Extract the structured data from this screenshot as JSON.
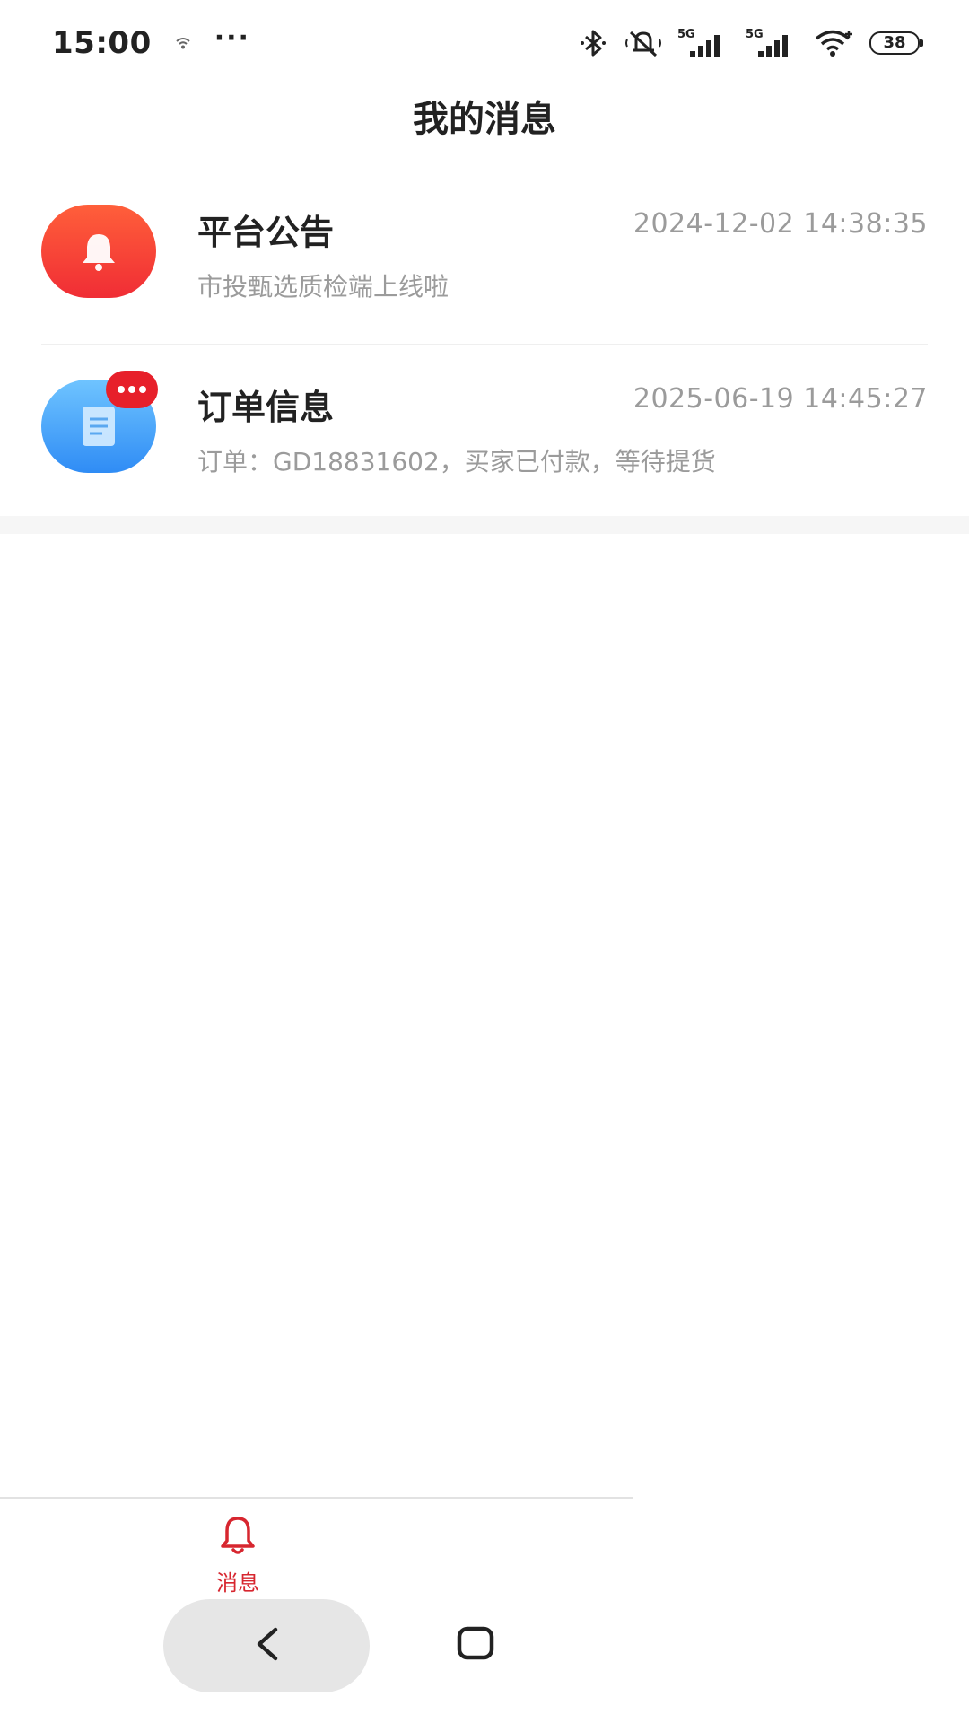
{
  "status_bar": {
    "time": "15:00",
    "dots": "···",
    "left_icon": "wifi-small-icon",
    "right_icons": [
      "bluetooth-icon",
      "mute-icon",
      "signal-5g-icon",
      "signal-5g-icon",
      "wifi-icon"
    ],
    "net_label_1": "5G",
    "net_label_2": "5G",
    "battery": "38"
  },
  "header": {
    "title": "我的消息"
  },
  "messages": [
    {
      "title": "平台公告",
      "time": "2024-12-02 14:38:35",
      "preview": "市投甄选质检端上线啦",
      "icon": "bell-icon",
      "avatar_color": "#f23b33"
    },
    {
      "title": "订单信息",
      "time": "2025-06-19 14:45:27",
      "preview": "订单：GD18831602，买家已付款，等待提货",
      "icon": "document-icon",
      "avatar_color": "#3b97f5",
      "badge": "···"
    }
  ],
  "tab_bar": {
    "items": [
      {
        "label": "消息",
        "icon": "bell-outline-icon",
        "active": true
      }
    ],
    "active_color": "#d7262f"
  },
  "nav_bar": {
    "back_icon": "back-chevron-icon",
    "home_icon": "home-square-icon"
  }
}
